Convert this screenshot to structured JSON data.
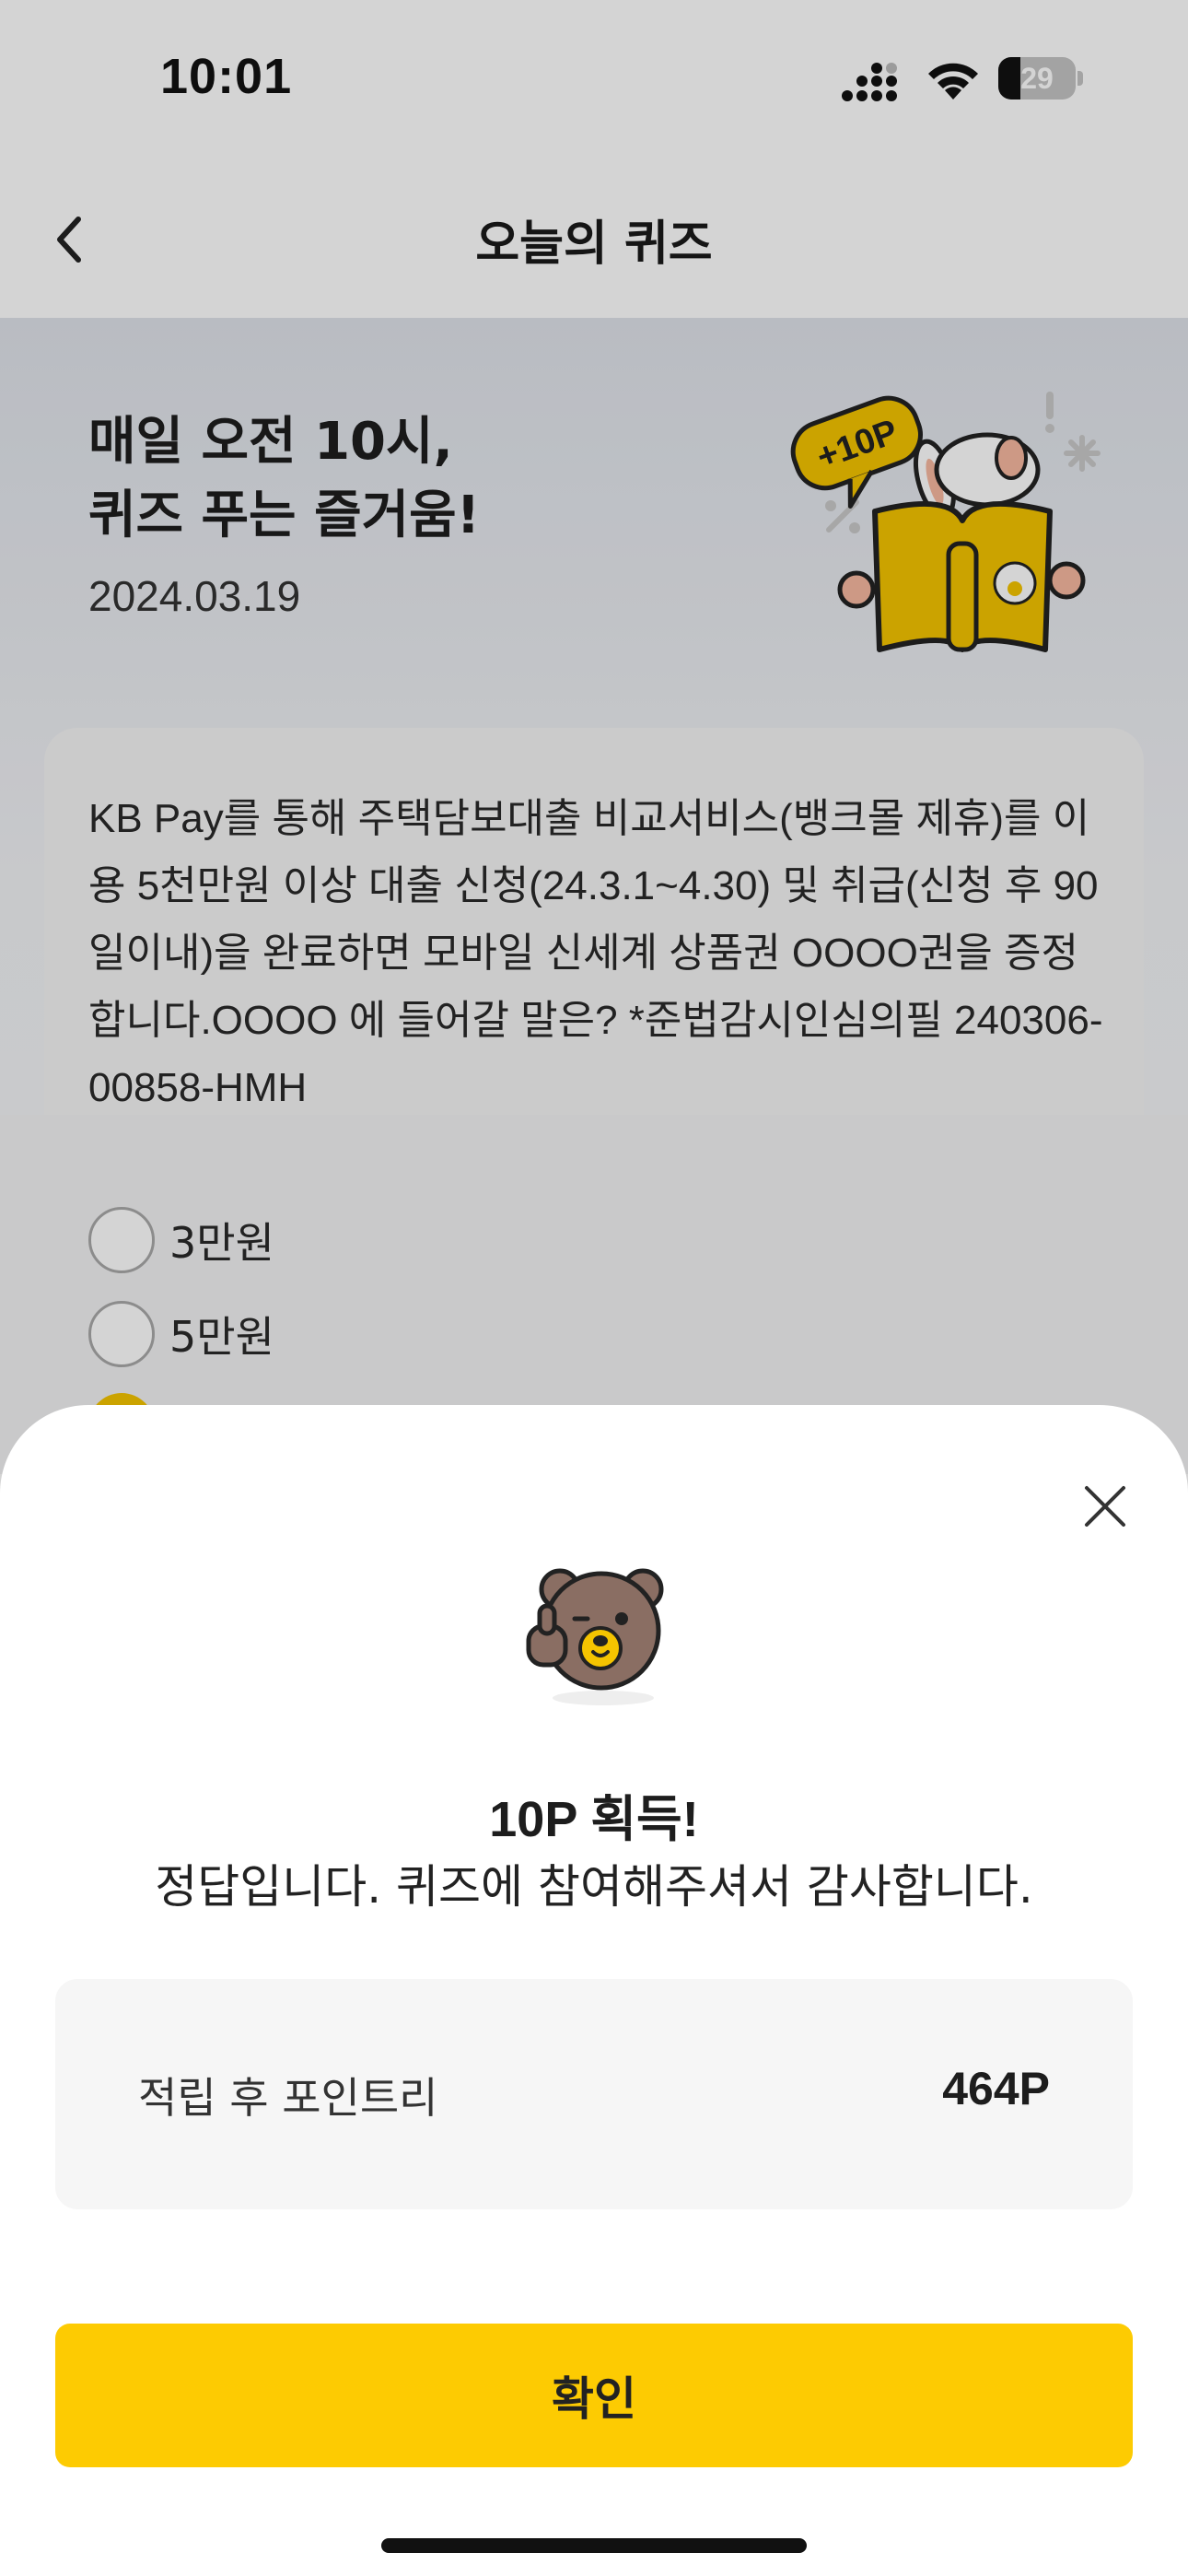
{
  "status_bar": {
    "time": "10:01",
    "battery_level": "29",
    "battery_fraction": 0.29
  },
  "header": {
    "title": "오늘의 퀴즈"
  },
  "hero": {
    "headline_line1": "매일 오전 10시,",
    "headline_line2": "퀴즈 푸는 즐거움!",
    "date": "2024.03.19",
    "badge": "+10P"
  },
  "quiz": {
    "question": "KB Pay를 통해 주택담보대출 비교서비스(뱅크몰 제휴)를 이용 5천만원 이상 대출 신청(24.3.1~4.30) 및 취급(신청 후 90일이내)을 완료하면 모바일 신세계 상품권 OOOO권을 증정합니다.OOOO 에 들어갈 말은? *준법감시인심의필 240306-00858-HMH",
    "options": [
      {
        "label": "3만원",
        "selected": false
      },
      {
        "label": "5만원",
        "selected": false
      }
    ]
  },
  "result_sheet": {
    "title": "10P 획득!",
    "message": "정답입니다. 퀴즈에 참여해주셔서 감사합니다.",
    "points_label": "적립 후 포인트리",
    "points_value": "464P",
    "confirm_label": "확인"
  },
  "colors": {
    "accent": "#fdcb02",
    "text": "#1d1d1d"
  },
  "icons": [
    "back-arrow-icon",
    "close-icon",
    "signal-icon",
    "wifi-icon",
    "battery-icon"
  ]
}
